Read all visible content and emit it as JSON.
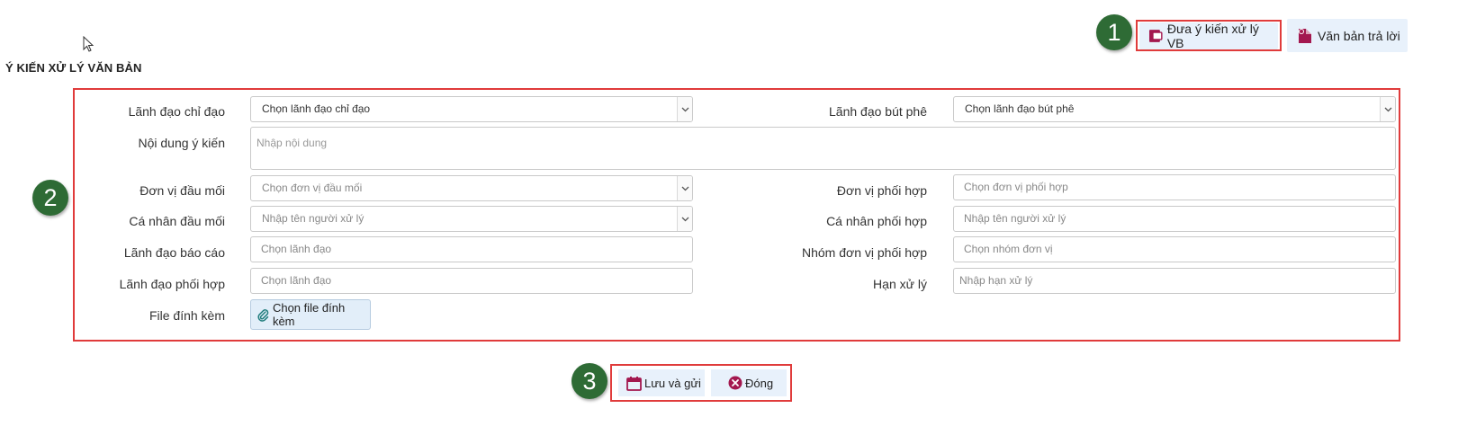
{
  "page_title": "Ý KIẾN XỬ LÝ VĂN BẢN",
  "toolbar": {
    "opinion_label": "Đưa ý kiến xử lý VB",
    "reply_label": "Văn bản trả lời"
  },
  "badges": [
    "1",
    "2",
    "3"
  ],
  "form": {
    "lead_direct": {
      "label": "Lãnh đạo chỉ đạo",
      "value": "Chọn lãnh đạo chỉ đạo"
    },
    "lead_note": {
      "label": "Lãnh đạo bút phê",
      "value": "Chọn lãnh đạo bút phê"
    },
    "content": {
      "label": "Nội dung ý kiến",
      "placeholder": "Nhập nội dung"
    },
    "unit_focal": {
      "label": "Đơn vị đầu mối",
      "placeholder": "Chọn đơn vị đầu mối"
    },
    "unit_coord": {
      "label": "Đơn vị phối hợp",
      "placeholder": "Chọn đơn vị phối hợp"
    },
    "person_focal": {
      "label": "Cá nhân đầu mối",
      "placeholder": "Nhập tên người xử lý"
    },
    "person_coord": {
      "label": "Cá nhân phối hợp",
      "placeholder": "Nhập tên người xử lý"
    },
    "lead_report": {
      "label": "Lãnh đạo báo cáo",
      "placeholder": "Chọn lãnh đạo"
    },
    "group_coord": {
      "label": "Nhóm đơn vị phối hợp",
      "placeholder": "Chọn nhóm đơn vị"
    },
    "lead_coord": {
      "label": "Lãnh đạo phối hợp",
      "placeholder": "Chọn lãnh đạo"
    },
    "deadline": {
      "label": "Hạn xử lý",
      "placeholder": "Nhập hạn xử lý"
    },
    "attachment": {
      "label": "File đính kèm",
      "button": "Chọn file đính kèm"
    }
  },
  "actions": {
    "save_label": "Lưu và gửi",
    "close_label": "Đóng"
  },
  "colors": {
    "badge": "#2e6b35",
    "highlight": "#e03b3b",
    "icon_accent": "#a3184f",
    "button_bg": "#e8f1fb"
  }
}
